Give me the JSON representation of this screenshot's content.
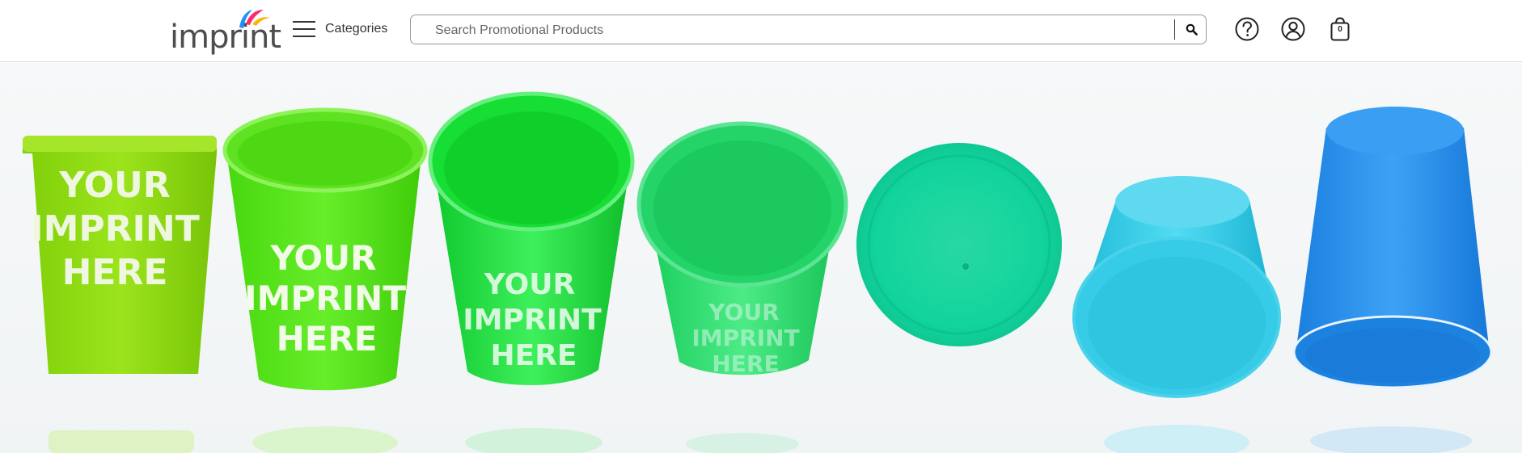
{
  "header": {
    "logo_text": "imprint",
    "categories_label": "Categories",
    "search": {
      "placeholder": "Search Promotional Products",
      "value": ""
    },
    "cart_count": "0",
    "icons": [
      "menu-icon",
      "search-icon",
      "help-icon",
      "account-icon",
      "shopping-bag-icon"
    ]
  },
  "hero": {
    "cup_text": [
      "YOUR",
      "IMPRINT",
      "HERE"
    ],
    "cup_colors": [
      "#8fd60e",
      "#55e41a",
      "#17d63a",
      "#21d86a",
      "#15dca6",
      "#29c5e3",
      "#1e8fea"
    ]
  },
  "brand_colors": {
    "logo_gray": "#4d4d4f",
    "swoosh": [
      "#ff2a6d",
      "#ffb300",
      "#1e90ff"
    ]
  }
}
